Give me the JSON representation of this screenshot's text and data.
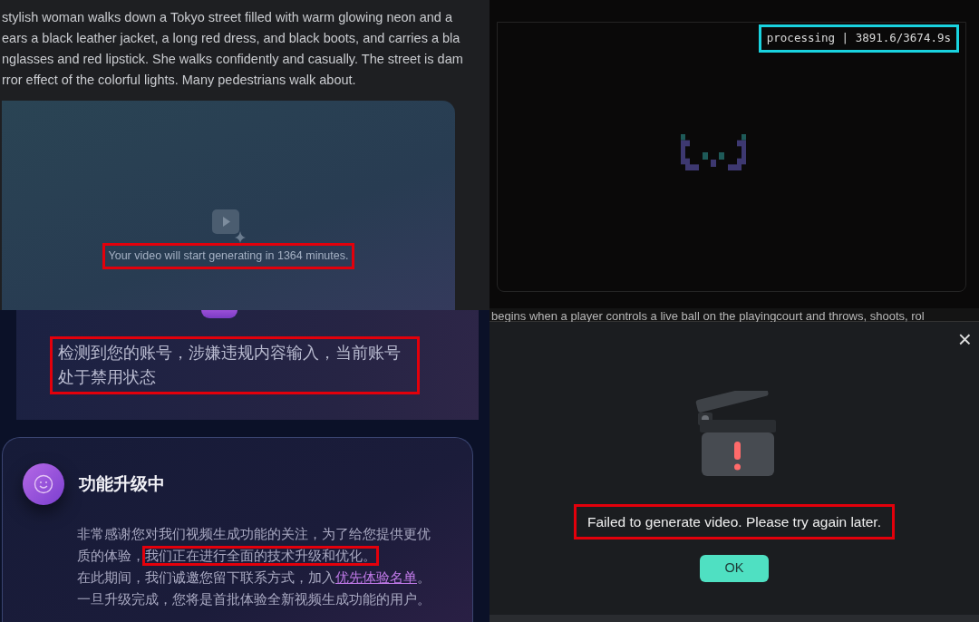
{
  "prompt_panel": {
    "lines": [
      "stylish woman walks down a Tokyo street filled with warm glowing neon and a",
      "ears a black leather jacket, a long red dress, and black boots, and carries a bla",
      "nglasses and red lipstick. She walks confidently and casually. The street is dam",
      "rror effect of the colorful lights. Many pedestrians walk about."
    ],
    "video_card": {
      "status": "Your video will start generating in 1364 minutes.",
      "highlighted": true
    }
  },
  "preview_panel": {
    "status": "processing | 3891.6/3674.9s",
    "highlighted": true,
    "caption": "begins when a player controls a live ball on the playingcourt and throws, shoots, rol"
  },
  "ban_notice": {
    "message": "检测到您的账号，涉嫌违规内容输入，当前账号处于禁用状态",
    "highlighted": true
  },
  "upgrade_card": {
    "title": "功能升级中",
    "body_lines": [
      [
        {
          "kind": "text",
          "text": "非常感谢您对我们视频生成功能的关注，为了给您提供更优",
          "highlighted": false
        }
      ],
      [
        {
          "kind": "text",
          "text": "质的体验，",
          "highlighted": false
        },
        {
          "kind": "text",
          "text": "我们正在进行全面的技术升级和优化。",
          "highlighted": true
        }
      ],
      [
        {
          "kind": "text",
          "text": "在此期间，我们诚邀您留下联系方式，加入",
          "highlighted": false
        },
        {
          "kind": "link",
          "text": "优先体验名单",
          "highlighted": false
        },
        {
          "kind": "text",
          "text": "。",
          "highlighted": false
        }
      ],
      [
        {
          "kind": "text",
          "text": "一旦升级完成，您将是首批体验全新视频生成功能的用户。",
          "highlighted": false
        }
      ]
    ]
  },
  "error_dialog": {
    "close": "×",
    "message": "Failed to generate video. Please try again later.",
    "highlighted": true,
    "button": "OK"
  }
}
